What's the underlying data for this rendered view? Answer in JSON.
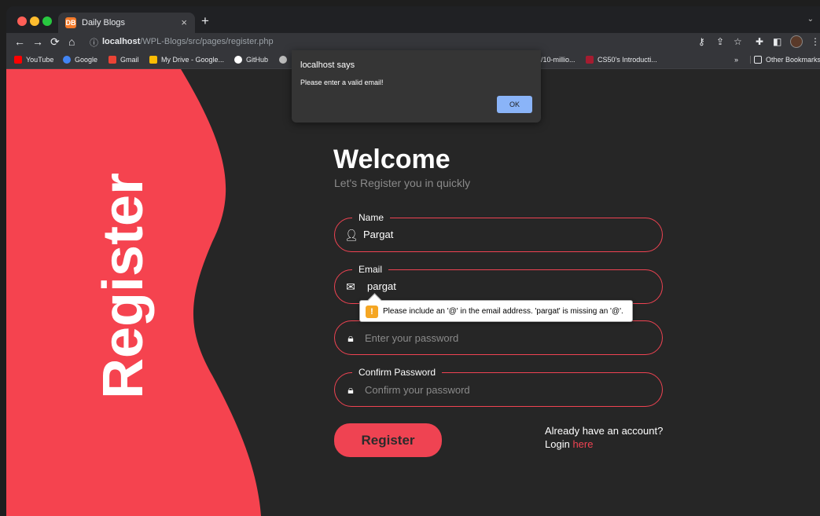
{
  "browser": {
    "tab_title": "Daily Blogs",
    "tab_favicon": "DB",
    "tab_close": "×",
    "new_tab": "+",
    "tab_menu": "⌄",
    "url_host": "localhost",
    "url_path": "/WPL-Blogs/src/pages/register.php",
    "bookmarks": [
      {
        "label": "YouTube",
        "color": "#ff0000"
      },
      {
        "label": "Google",
        "color": "#4285f4"
      },
      {
        "label": "Gmail",
        "color": "#ea4335"
      },
      {
        "label": "My Drive - Google...",
        "color": "#fbbc04"
      },
      {
        "label": "GitHub",
        "color": "#ffffff"
      }
    ],
    "bookmark_partial": "/10-millio...",
    "bookmark_cs50": "CS50's Introducti...",
    "bookmarks_overflow": "»",
    "other_bookmarks": "Other Bookmarks"
  },
  "dialog": {
    "title": "localhost says",
    "message": "Please enter a valid email!",
    "ok_label": "OK"
  },
  "sidebar": {
    "vertical_title": "Register",
    "accent_color": "#ef4352"
  },
  "form": {
    "heading": "Welcome",
    "subheading": "Let's Register you in quickly",
    "name_label": "Name",
    "name_value": "Pargat",
    "email_label": "Email",
    "email_value": "pargat",
    "password_placeholder": "Enter your password",
    "confirm_label": "Confirm Password",
    "confirm_placeholder": "Confirm your password",
    "register_label": "Register",
    "already_text": "Already have an account?",
    "login_text": "Login",
    "login_link": "here"
  },
  "validation": {
    "icon": "!",
    "message": "Please include an '@' in the email address. 'pargat' is missing an '@'."
  }
}
